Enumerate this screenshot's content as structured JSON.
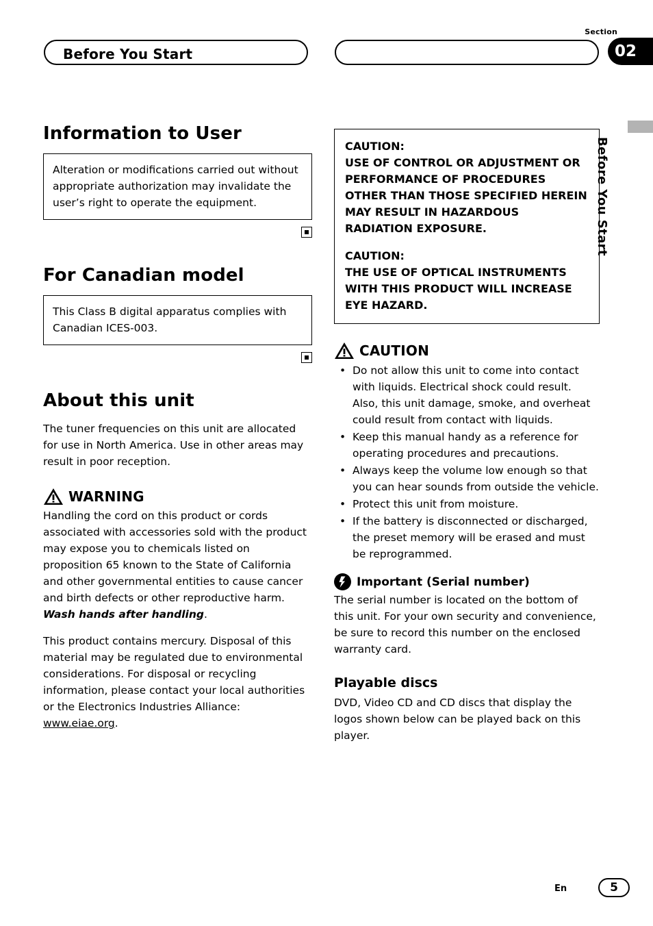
{
  "header": {
    "left_tab_label": "Before You Start",
    "section_word": "Section",
    "section_number": "02",
    "edge_tab_label": "Before You Start"
  },
  "left_column": {
    "h_information": "Information to User",
    "information_box": "Alteration or modifications carried out without appropriate authorization may invalidate the user’s right to operate the equipment.",
    "h_canadian": "For Canadian model",
    "canadian_box": "This Class B digital apparatus complies with Canadian ICES-003.",
    "h_about": "About this unit",
    "about_text": "The tuner frequencies on this unit are allocated for use in North America. Use in other areas may result in poor reception.",
    "warning_title": "WARNING",
    "warning_icon": "warning-triangle-icon",
    "warning_p1_a": "Handling the cord on this product or cords associated with accessories sold with the product may expose you to chemicals listed on proposition 65 known to the State of California and other governmental entities to cause cancer and birth defects or other reproductive harm. ",
    "warning_p1_emph": "Wash hands after handling",
    "warning_p1_end": ".",
    "warning_p2_a": "This product contains mercury. Disposal of this material may be regulated due to environmental considerations. For disposal or recycling information, please contact your local authorities or the Electronics Industries Alliance: ",
    "warning_p2_link": "www.eiae.org",
    "warning_p2_end": "."
  },
  "right_column": {
    "caution_box": {
      "label1": "CAUTION:",
      "text1": "USE OF CONTROL OR ADJUSTMENT OR PERFORMANCE OF PROCEDURES OTHER THAN THOSE SPECIFIED HEREIN MAY RESULT IN HAZARDOUS RADIATION EXPOSURE.",
      "label2": "CAUTION:",
      "text2": "THE USE OF OPTICAL INSTRUMENTS WITH THIS PRODUCT WILL INCREASE EYE HAZARD."
    },
    "caution_title": "CAUTION",
    "caution_icon": "warning-triangle-icon",
    "caution_bullets": [
      "Do not allow this unit to come into contact with liquids. Electrical shock could result. Also, this unit damage, smoke, and overheat could result from contact with liquids.",
      "Keep this manual handy as a reference for operating procedures and precautions.",
      "Always keep the volume low enough so that you can hear sounds from outside the vehicle.",
      "Protect this unit from moisture.",
      "If the battery is disconnected or discharged, the preset memory will be erased and must be reprogrammed."
    ],
    "important_title": "Important (Serial number)",
    "important_icon": "note-circle-icon",
    "important_text": "The serial number is located on the bottom of this unit. For your own security and convenience, be sure to record this number on the enclosed warranty card.",
    "h_playable": "Playable discs",
    "playable_text": "DVD, Video CD and CD discs that display the logos shown below can be played back on this player."
  },
  "footer": {
    "language": "En",
    "page_number": "5"
  },
  "colors": {
    "ink": "#000000",
    "paper": "#ffffff",
    "edge_tab": "#b3b3b3"
  }
}
